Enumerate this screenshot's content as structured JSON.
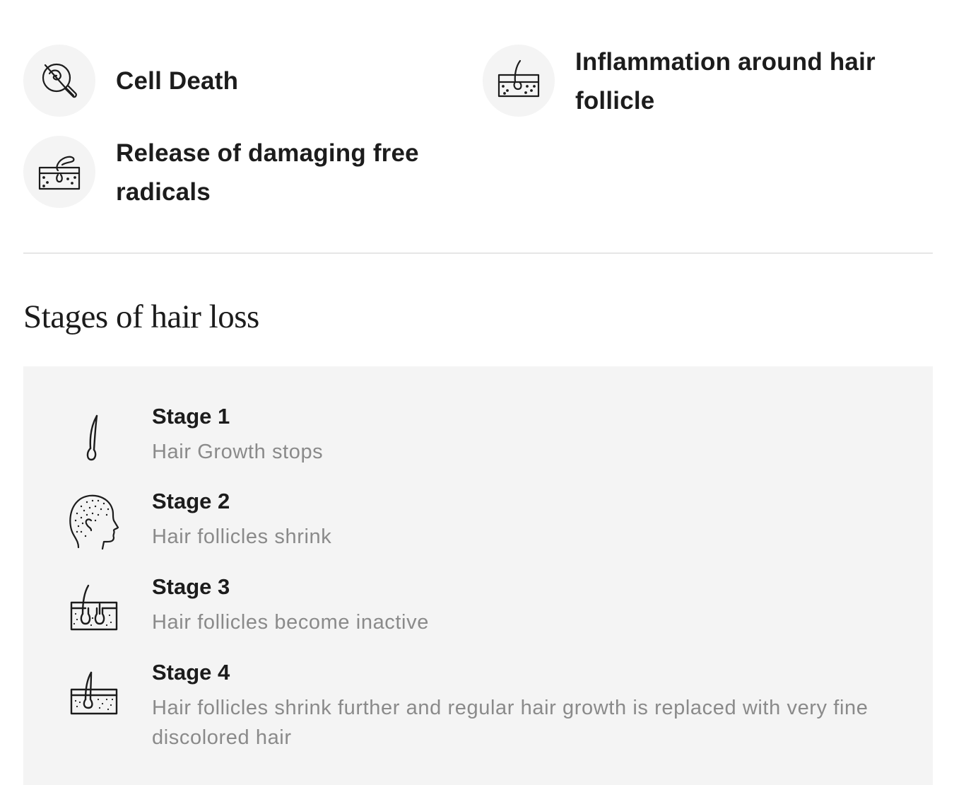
{
  "effects": [
    {
      "label": "Cell Death",
      "icon": "cell-death-icon"
    },
    {
      "label": "Inflammation around hair follicle",
      "icon": "inflamed-follicle-icon"
    },
    {
      "label": "Release of damaging free radicals",
      "icon": "free-radicals-icon"
    }
  ],
  "stages_section": {
    "title": "Stages of hair loss",
    "stages": [
      {
        "title": "Stage 1",
        "description": "Hair Growth stops",
        "icon": "single-hair-icon"
      },
      {
        "title": "Stage 2",
        "description": "Hair follicles shrink",
        "icon": "head-profile-icon"
      },
      {
        "title": "Stage 3",
        "description": "Hair follicles become inactive",
        "icon": "inactive-follicles-icon"
      },
      {
        "title": "Stage 4",
        "description": "Hair follicles shrink further and regular hair growth is replaced with very fine discolored hair",
        "icon": "fine-hair-follicle-icon"
      }
    ]
  },
  "colors": {
    "text": "#1c1c1c",
    "muted_text": "#8a8a8a",
    "panel_bg": "#f4f4f4",
    "divider": "#e6e6e6"
  }
}
